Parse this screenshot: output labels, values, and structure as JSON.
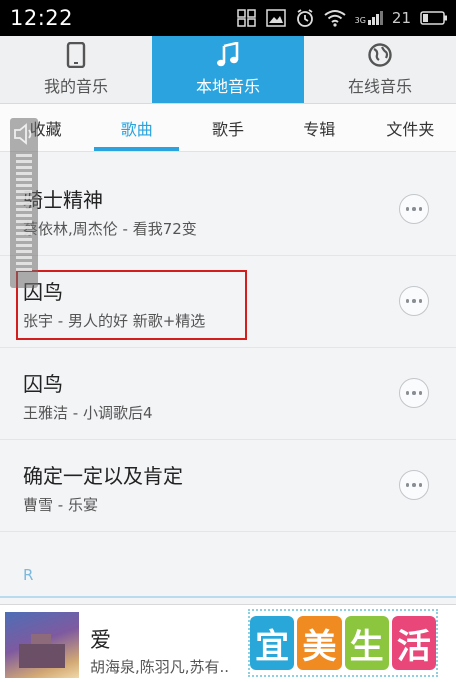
{
  "status_bar": {
    "time": "12:22",
    "signal_label": "3G",
    "battery_text": "21"
  },
  "top_tabs": [
    {
      "label": "我的音乐",
      "icon": "phone-icon",
      "active": false
    },
    {
      "label": "本地音乐",
      "icon": "music-note-icon",
      "active": true
    },
    {
      "label": "在线音乐",
      "icon": "globe-icon",
      "active": false
    }
  ],
  "sub_tabs": [
    {
      "label": "收藏",
      "active": false
    },
    {
      "label": "歌曲",
      "active": true
    },
    {
      "label": "歌手",
      "active": false
    },
    {
      "label": "专辑",
      "active": false
    },
    {
      "label": "文件夹",
      "active": false
    }
  ],
  "songs": [
    {
      "title": "骑士精神",
      "subtitle": "蔡依林,周杰伦  - 看我72变"
    },
    {
      "title": "囚鸟",
      "subtitle": "张宇  - 男人的好 新歌+精选"
    },
    {
      "title": "囚鸟",
      "subtitle": "王雅洁  - 小调歌后4"
    },
    {
      "title": "确定一定以及肯定",
      "subtitle": "曹雪  - 乐宴"
    }
  ],
  "section": {
    "letter": "R"
  },
  "player": {
    "title": "爱",
    "artist": "胡海泉,陈羽凡,苏有.."
  },
  "ad": {
    "chars": [
      "宜",
      "美",
      "生",
      "活"
    ],
    "colors": [
      "#29a7d8",
      "#f08b21",
      "#8cc63f",
      "#e9477a"
    ]
  },
  "colors": {
    "accent": "#2aa3de",
    "highlight": "#d41d1d"
  }
}
